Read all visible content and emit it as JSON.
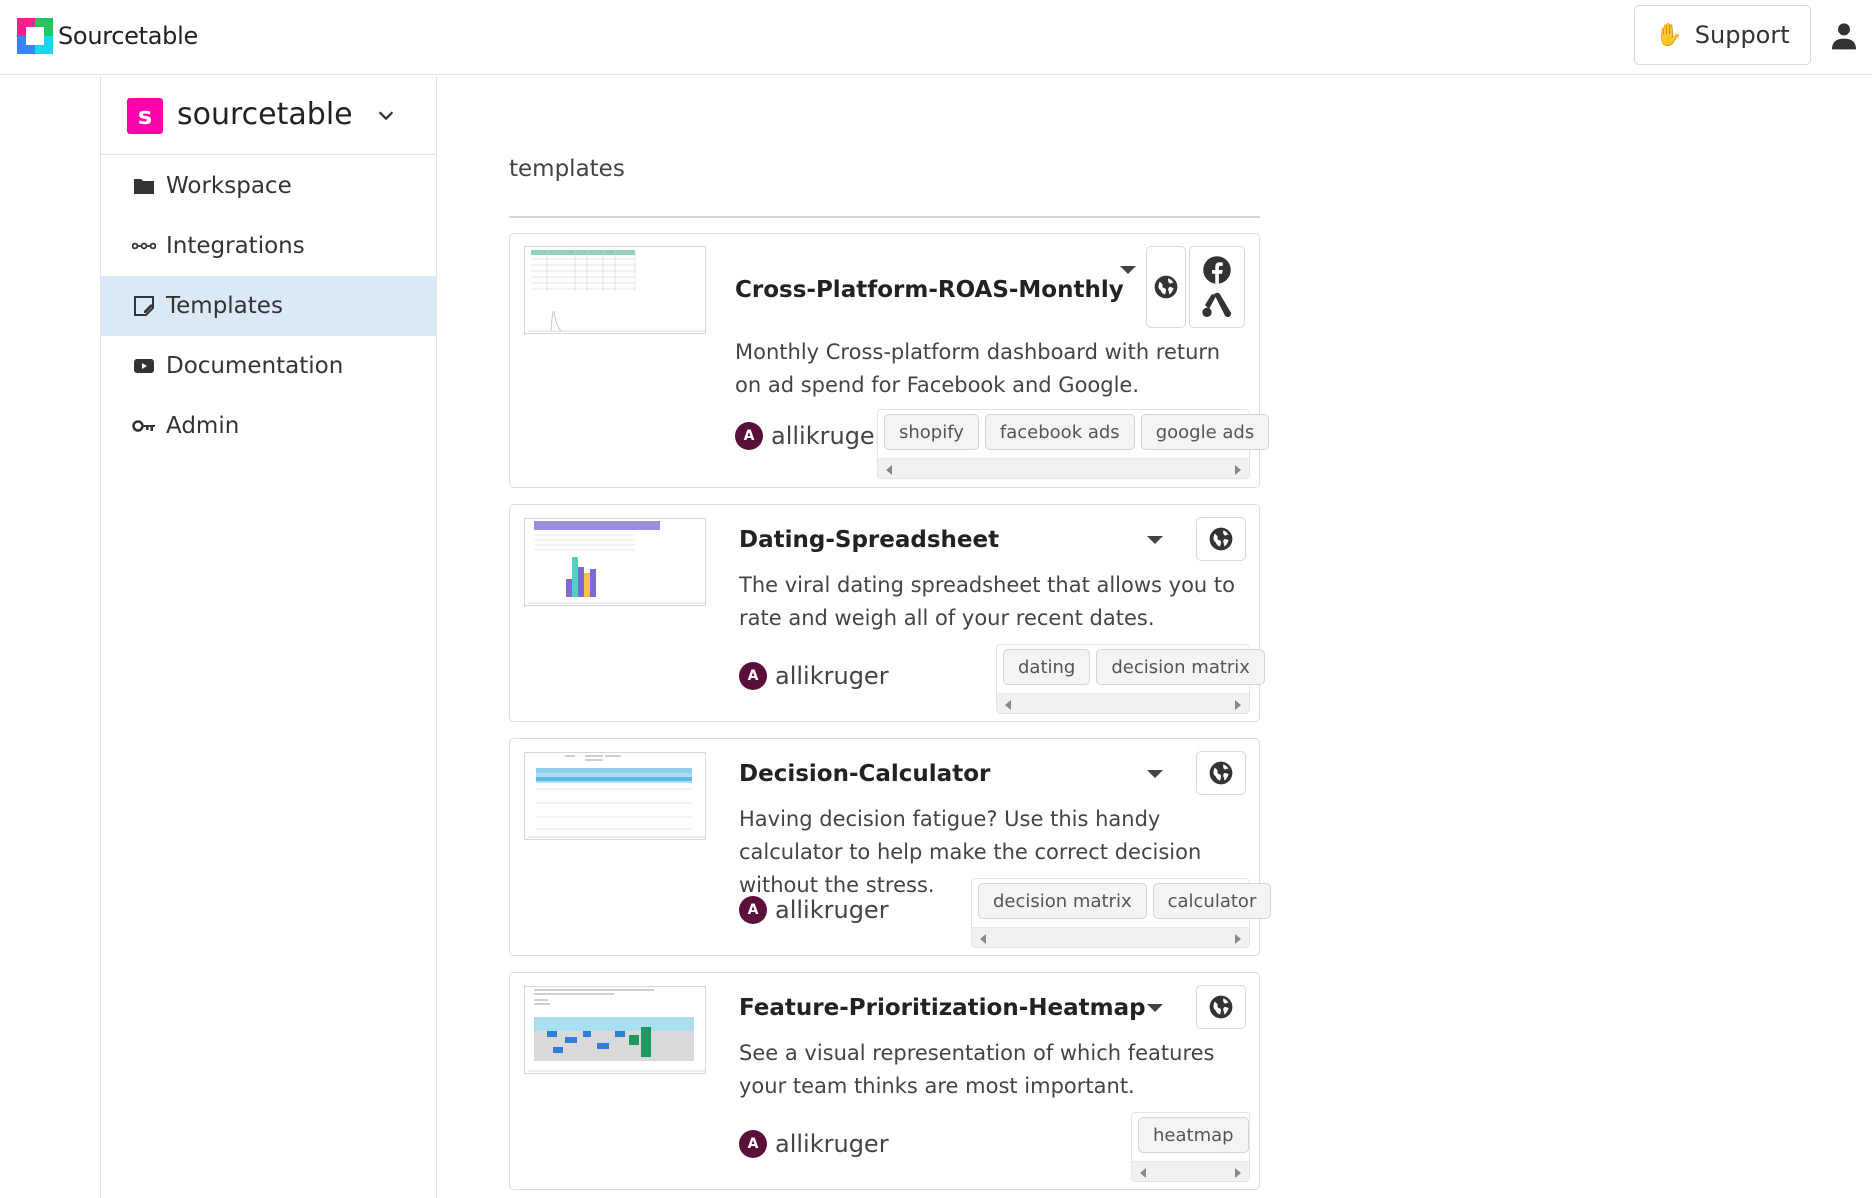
{
  "app": {
    "brand": "Sourcetable",
    "support_label": "Support",
    "support_emoji": "✋",
    "colors": {
      "accent_magenta": "#ff00aa",
      "active_nav": "#dbe8f7",
      "avatar": "#5a0f3a"
    }
  },
  "sidebar": {
    "org_initial": "s",
    "org_name": "sourcetable",
    "items": [
      {
        "label": "Workspace",
        "icon": "folder-icon"
      },
      {
        "label": "Integrations",
        "icon": "integrations-icon"
      },
      {
        "label": "Templates",
        "icon": "templates-icon",
        "active": true
      },
      {
        "label": "Documentation",
        "icon": "youtube-icon"
      },
      {
        "label": "Admin",
        "icon": "key-icon"
      }
    ]
  },
  "main": {
    "section_title": "templates",
    "cards": [
      {
        "title": "Cross-Platform-ROAS-Monthly",
        "description": "Monthly Cross-platform dashboard with return on ad spend for Facebook and Google.",
        "author_initial": "A",
        "author": "allikruger",
        "tags": [
          "shopify",
          "facebook ads",
          "google ads"
        ],
        "icons": [
          "globe-icon",
          "facebook-icon",
          "google-ads-icon"
        ]
      },
      {
        "title": "Dating-Spreadsheet",
        "description": "The viral dating spreadsheet that allows you to rate and weigh all of your recent dates.",
        "author_initial": "A",
        "author": "allikruger",
        "tags": [
          "dating",
          "decision matrix"
        ],
        "icons": [
          "globe-icon"
        ]
      },
      {
        "title": "Decision-Calculator",
        "description": "Having decision fatigue? Use this handy calculator to help make the correct decision without the stress.",
        "author_initial": "A",
        "author": "allikruger",
        "tags": [
          "decision matrix",
          "calculator"
        ],
        "icons": [
          "globe-icon"
        ]
      },
      {
        "title": "Feature-Prioritization-Heatmap",
        "description": "See a visual representation of which features your team thinks are most important.",
        "author_initial": "A",
        "author": "allikruger",
        "tags": [
          "heatmap"
        ],
        "icons": [
          "globe-icon"
        ]
      }
    ]
  }
}
